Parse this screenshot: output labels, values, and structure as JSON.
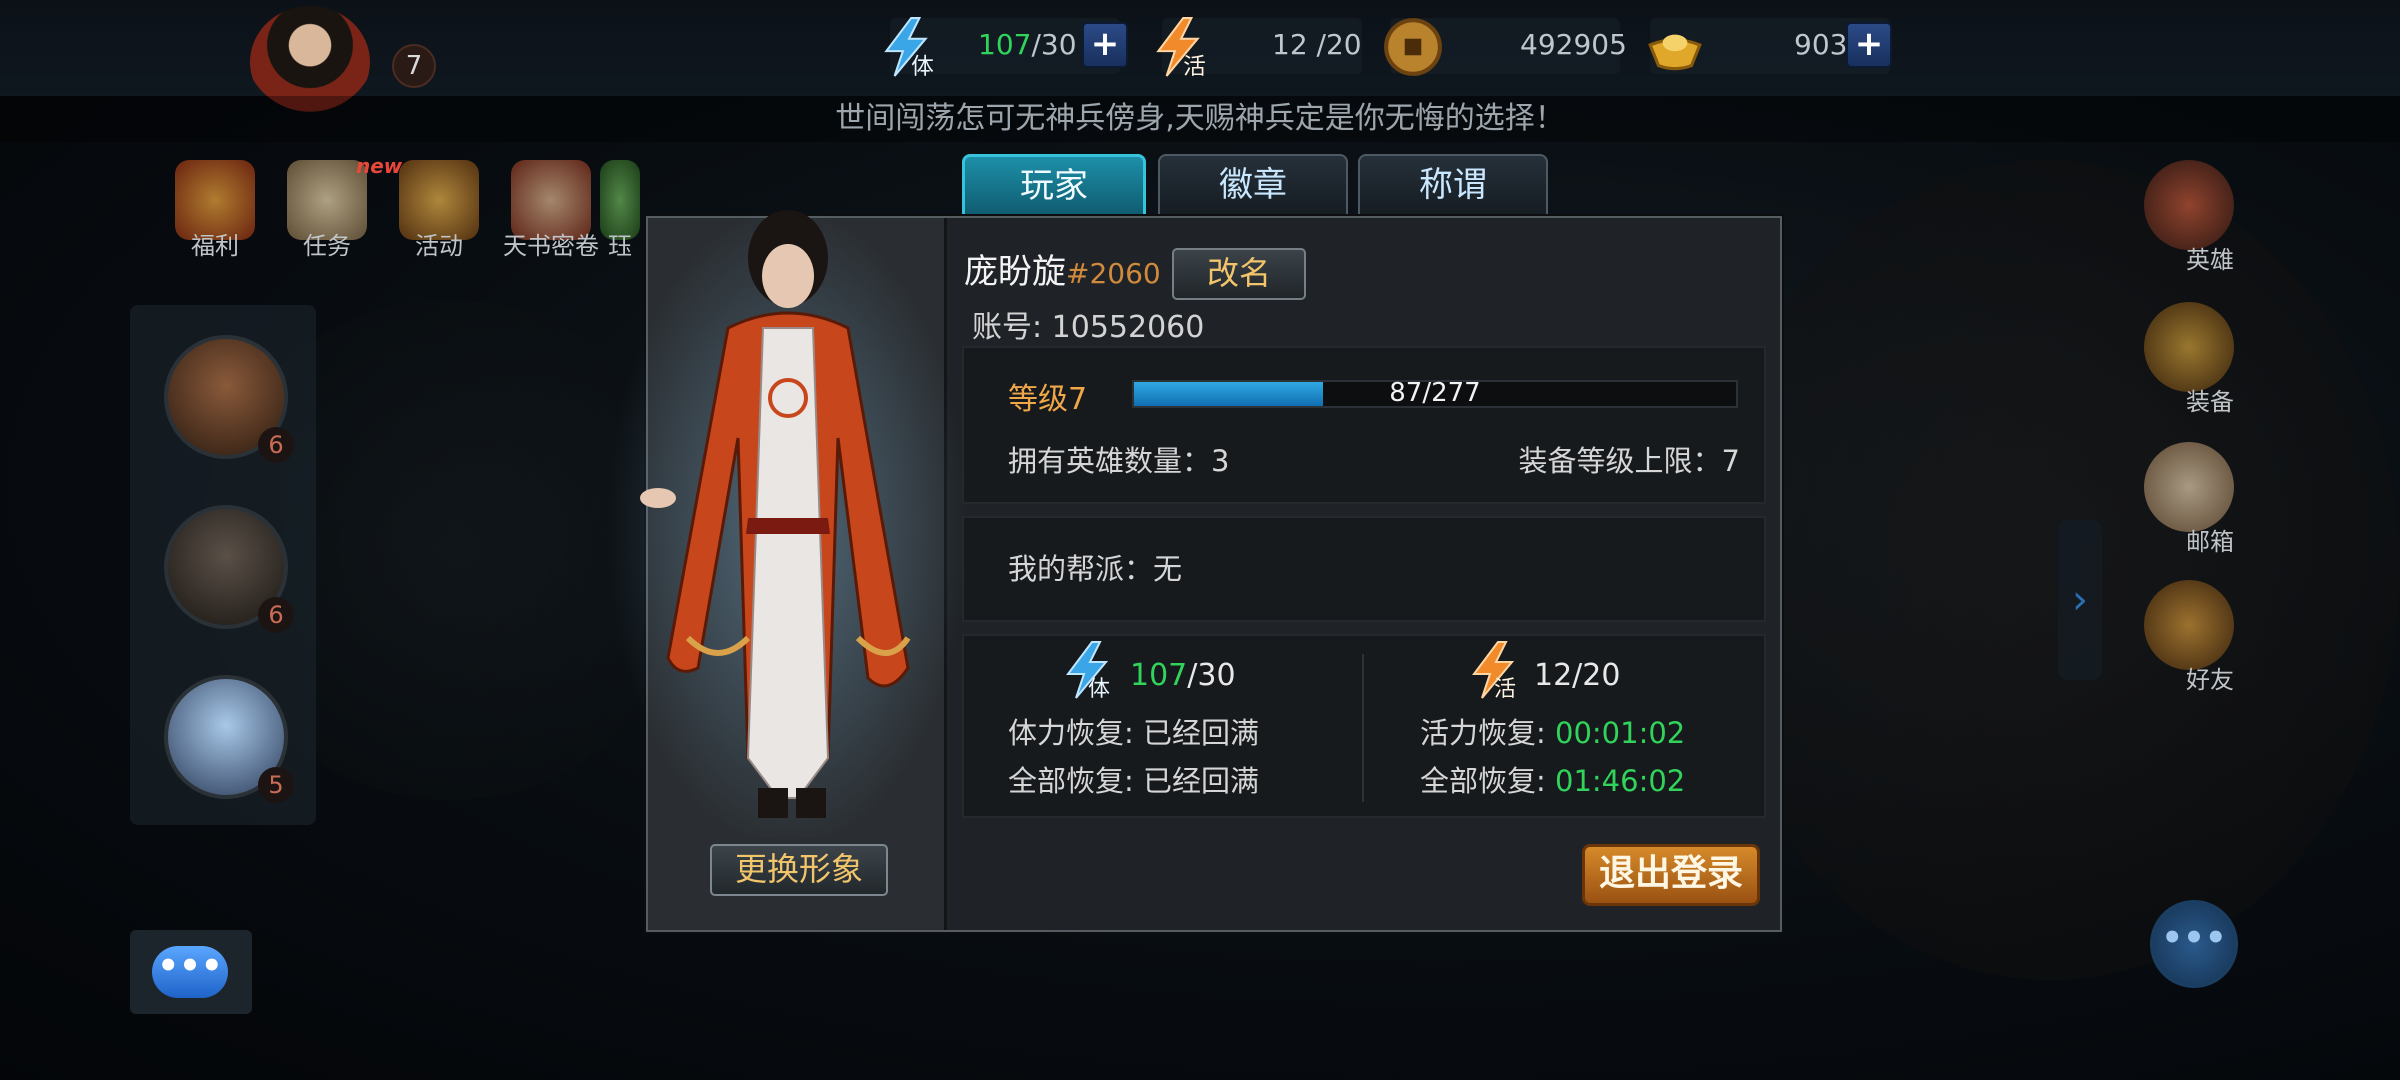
{
  "topbar": {
    "player_level": "7",
    "stamina": {
      "current": "107",
      "max": "/30"
    },
    "vigor": {
      "value": "12 /20"
    },
    "coins": "492905",
    "ingots": "903",
    "stamina_icon_char": "体",
    "vigor_icon_char": "活"
  },
  "ticker_text": "世间闯荡怎可无神兵傍身,天赐神兵定是你无悔的选择！",
  "activities": [
    {
      "label": "福利"
    },
    {
      "label": "任务",
      "badge": "new"
    },
    {
      "label": "活动"
    },
    {
      "label": "天书密卷"
    },
    {
      "label": "珏"
    }
  ],
  "heroes": [
    {
      "level": "6"
    },
    {
      "level": "6"
    },
    {
      "level": "5"
    }
  ],
  "right_menu": [
    {
      "label": "英雄"
    },
    {
      "label": "装备"
    },
    {
      "label": "邮箱"
    },
    {
      "label": "好友"
    }
  ],
  "tabs": [
    {
      "label": "玩家",
      "active": true
    },
    {
      "label": "徽章",
      "active": false
    },
    {
      "label": "称谓",
      "active": false
    }
  ],
  "player": {
    "name": "庞盼旋",
    "tag": "#2060",
    "rename_label": "改名",
    "account": "账号: 10552060",
    "change_look_label": "更换形象",
    "level_label": "等级7",
    "xp_text": "87/277",
    "xp_fraction": 0.314,
    "hero_count": "拥有英雄数量：3",
    "equip_limit": "装备等级上限：7",
    "guild": "我的帮派：无",
    "stamina_current": "107",
    "stamina_max": "/30",
    "stamina_recover_label": "体力恢复:",
    "stamina_recover_value": "已经回满",
    "stamina_full_label": "全部恢复:",
    "stamina_full_value": "已经回满",
    "vigor_value": "12/20",
    "vigor_recover_label": "活力恢复:",
    "vigor_recover_value": "00:01:02",
    "vigor_full_label": "全部恢复:",
    "vigor_full_value": "01:46:02",
    "logout_label": "退出登录"
  },
  "colors": {
    "accent_gold": "#f2c56b",
    "level_orange": "#f0a747",
    "timer_green": "#31d35a",
    "xp_blue": "#2fa9e3"
  }
}
